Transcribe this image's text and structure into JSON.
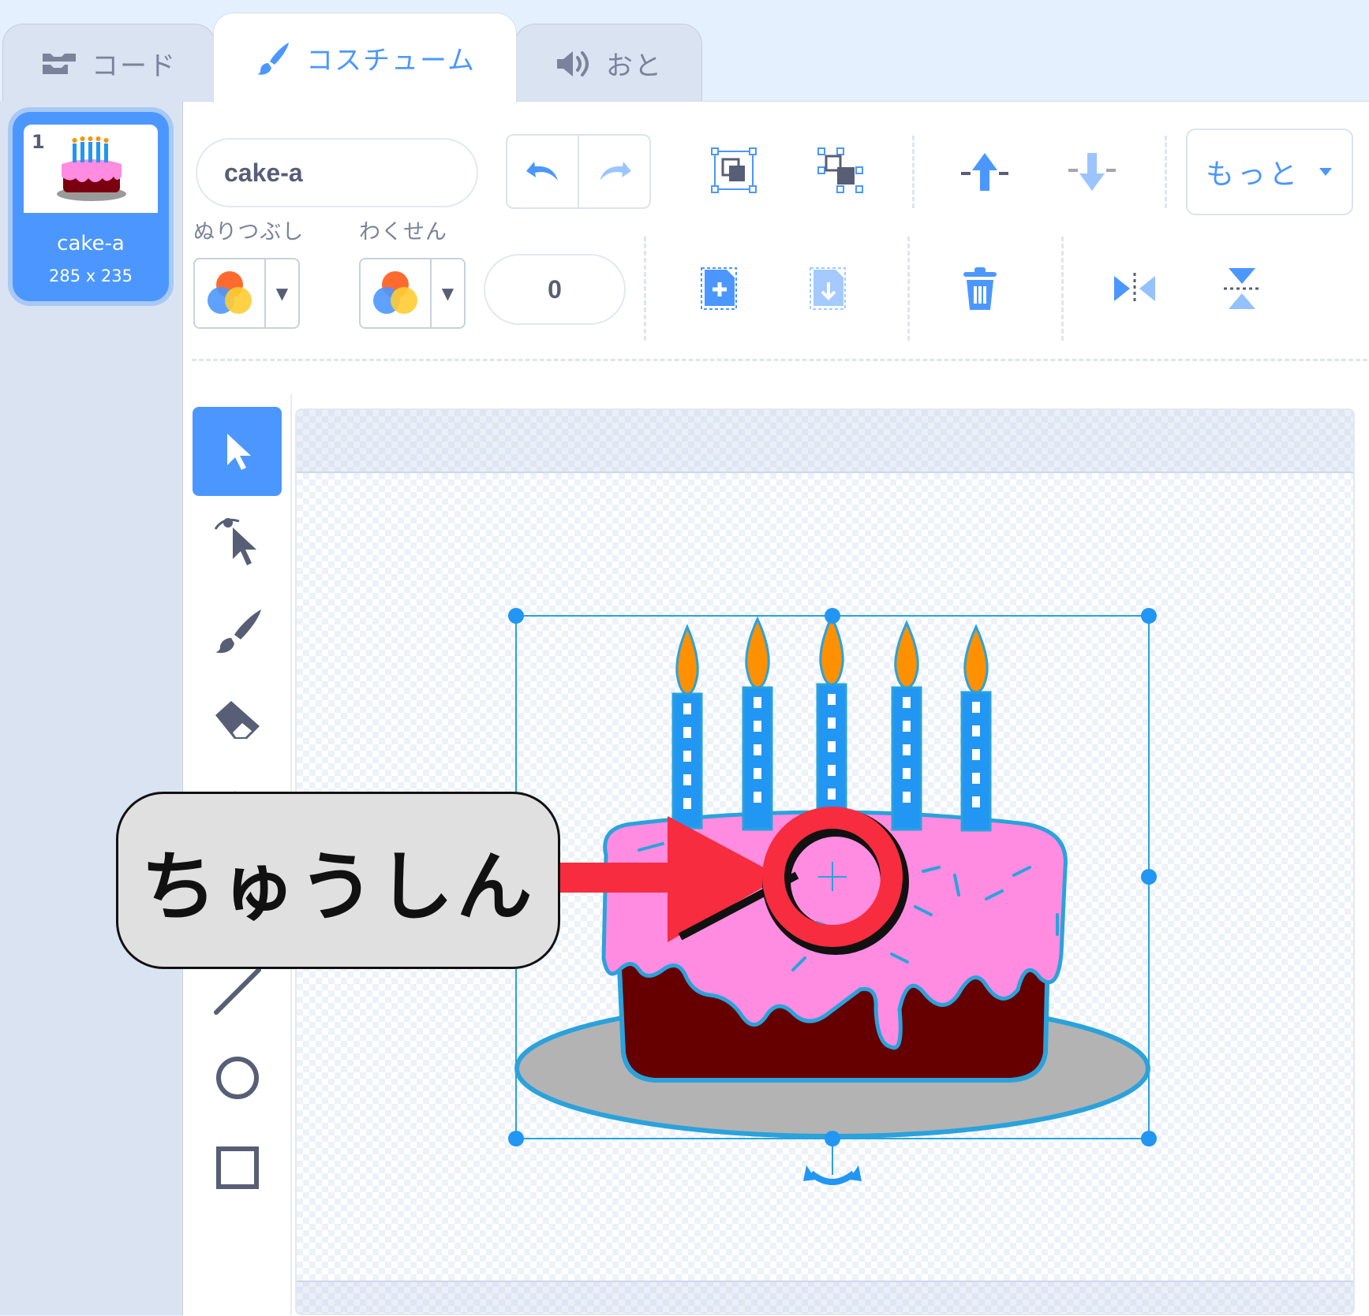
{
  "tabs": [
    {
      "label": "コード",
      "icon": "code-blocks-icon"
    },
    {
      "label": "コスチューム",
      "icon": "brush-icon",
      "active": true
    },
    {
      "label": "おと",
      "icon": "speaker-icon"
    }
  ],
  "costumes": [
    {
      "number": "1",
      "name": "cake-a",
      "size": "285 x 235",
      "selected": true
    }
  ],
  "toolbar": {
    "costume_name": "cake-a",
    "more_label": "もっと",
    "fill_label": "ぬりつぶし",
    "outline_label": "わくせん",
    "stroke_width": "0"
  },
  "tools": [
    "select-tool",
    "reshape-tool",
    "brush-tool",
    "eraser-tool",
    "fill-tool",
    "text-tool",
    "line-tool",
    "circle-tool",
    "rectangle-tool"
  ],
  "annotation": {
    "callout_text": "ちゅうしん"
  },
  "colors": {
    "accent": "#4c97ff",
    "callout_arrow": "#f72c3f",
    "icing": "#ff8ce0",
    "cake": "#660000",
    "plate": "#b3b3b3",
    "candle": "#2196f3",
    "flame": "#ff9000"
  }
}
